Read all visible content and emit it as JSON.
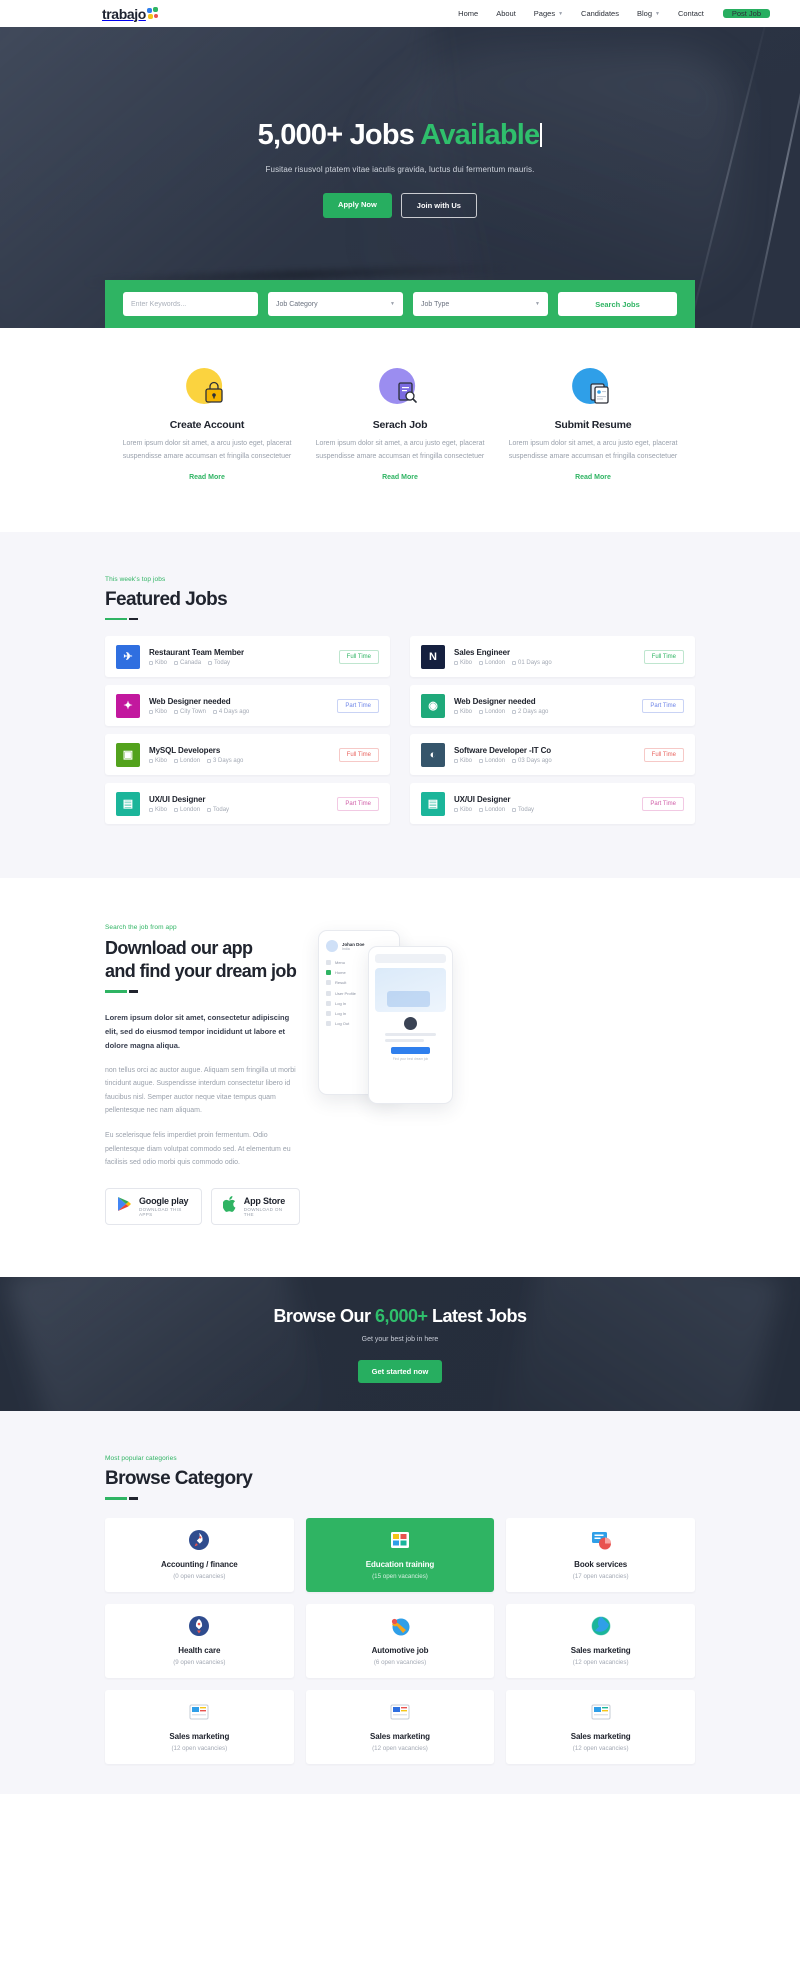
{
  "brand": {
    "name": "trabajo",
    "accent": "#2fb463"
  },
  "nav": {
    "items": [
      {
        "label": "Home",
        "caret": false
      },
      {
        "label": "About",
        "caret": false
      },
      {
        "label": "Pages",
        "caret": true
      },
      {
        "label": "Candidates",
        "caret": false
      },
      {
        "label": "Blog",
        "caret": true
      },
      {
        "label": "Contact",
        "caret": false
      }
    ],
    "cta": "Post Job"
  },
  "hero": {
    "title_plain": "5,000+ Jobs ",
    "title_accent": "Available",
    "subtitle": "Fusitae risusvol ptatem vitae iaculis gravida, luctus dui fermentum mauris.",
    "primary_button": "Apply Now",
    "secondary_button": "Join with Us"
  },
  "search": {
    "keyword_placeholder": "Enter Keywords...",
    "category_value": "Job Category",
    "type_value": "Job Type",
    "submit_label": "Search Jobs"
  },
  "features": [
    {
      "title": "Create Account",
      "text": "Lorem ipsum dolor sit amet, a arcu justo eget, placerat suspendisse amare accumsan et fringilla consectetuer",
      "link": "Read More",
      "icon": "lock-icon",
      "blob": "#fbd33f"
    },
    {
      "title": "Serach Job",
      "text": "Lorem ipsum dolor sit amet, a arcu justo eget, placerat suspendisse amare accumsan et fringilla consectetuer",
      "link": "Read More",
      "icon": "document-search-icon",
      "blob": "#9b8df0"
    },
    {
      "title": "Submit Resume",
      "text": "Lorem ipsum dolor sit amet, a arcu justo eget, placerat suspendisse amare accumsan et fringilla consectetuer",
      "link": "Read More",
      "icon": "resume-icon",
      "blob": "#2f9fe8"
    }
  ],
  "featured_jobs": {
    "eyebrow": "This week's top jobs",
    "title": "Featured Jobs",
    "items": [
      {
        "title": "Restaurant Team Member",
        "company": "Kibo",
        "location": "Canada",
        "posted": "Today",
        "tag": "Full Time",
        "tag_style": "tag-full",
        "logo_bg": "#2f6fe0",
        "logo_glyph": "✈"
      },
      {
        "title": "Sales Engineer",
        "company": "Kibo",
        "location": "London",
        "posted": "01 Days ago",
        "tag": "Full Time",
        "tag_style": "tag-full",
        "logo_bg": "#15203f",
        "logo_glyph": "N"
      },
      {
        "title": "Web Designer needed",
        "company": "Kibo",
        "location": "City Town",
        "posted": "4 Days ago",
        "tag": "Part Time",
        "tag_style": "tag-part",
        "logo_bg": "#c2189e",
        "logo_glyph": "✦"
      },
      {
        "title": "Web Designer needed",
        "company": "Kibo",
        "location": "London",
        "posted": "2 Days ago",
        "tag": "Part Time",
        "tag_style": "tag-part",
        "logo_bg": "#1fa97a",
        "logo_glyph": "◉"
      },
      {
        "title": "MySQL Developers",
        "company": "Kibo",
        "location": "London",
        "posted": "3 Days ago",
        "tag": "Full Time",
        "tag_style": "tag-full-r",
        "logo_bg": "#53a21d",
        "logo_glyph": "▣"
      },
      {
        "title": "Software Developer -IT Co",
        "company": "Kibo",
        "location": "London",
        "posted": "03 Days ago",
        "tag": "Full Time",
        "tag_style": "tag-full-r",
        "logo_bg": "#35556b",
        "logo_glyph": "◐"
      },
      {
        "title": "UX/UI Designer",
        "company": "Kibo",
        "location": "London",
        "posted": "Today",
        "tag": "Part Time",
        "tag_style": "tag-part-p",
        "logo_bg": "#1bb59a",
        "logo_glyph": "▤"
      },
      {
        "title": "UX/UI Designer",
        "company": "Kibo",
        "location": "London",
        "posted": "Today",
        "tag": "Part Time",
        "tag_style": "tag-part-p",
        "logo_bg": "#1bb59a",
        "logo_glyph": "▤"
      }
    ]
  },
  "app": {
    "eyebrow": "Search the job from app",
    "title_line1": "Download our app",
    "title_line2": "and find your dream job",
    "lead": "Lorem ipsum dolor sit amet, consectetur adipiscing elit, sed do eiusmod tempor incididunt ut labore et dolore magna aliqua.",
    "body1": "non tellus orci ac auctor augue. Aliquam sem fringilla ut morbi tincidunt augue. Suspendisse interdum consectetur libero id faucibus nisl. Semper auctor neque vitae tempus quam pellentesque nec nam aliquam.",
    "body2": "Eu scelerisque felis imperdiet proin fermentum. Odio pellentesque diam volutpat commodo sed. At elementum eu facilisis sed odio morbi quis commodo odio.",
    "store": [
      {
        "name": "Google play",
        "sub": "DOWNLOAD THIS APPS",
        "icon": "google-play-icon"
      },
      {
        "name": "App Store",
        "sub": "DOWNLOAD ON THE",
        "icon": "apple-icon"
      }
    ],
    "phone_mock": {
      "user_name": "Johan Doe",
      "user_role": "India",
      "menu_items": [
        "Menu",
        "Home",
        "Result",
        "User Profile",
        "Log In",
        "Log In",
        "Log Out"
      ],
      "card_button": "Sign In",
      "caption": "Find your best dream job"
    }
  },
  "cta": {
    "title_pre": "Browse Our ",
    "title_accent": "6,000+",
    "title_post": " Latest Jobs",
    "subtitle": "Get your best job in here",
    "button": "Get started now"
  },
  "categories": {
    "eyebrow": "Most popular categories",
    "title": "Browse Category",
    "items": [
      {
        "name": "Accounting / finance",
        "vacancies": "(0 open vacancies)",
        "active": false,
        "icon": "rocket-icon",
        "c1": "#2f6fe0",
        "c2": "#e8534f"
      },
      {
        "name": "Education training",
        "vacancies": "(15 open vacancies)",
        "active": true,
        "icon": "books-icon",
        "c1": "#f5c518",
        "c2": "#e8534f"
      },
      {
        "name": "Book services",
        "vacancies": "(17 open vacancies)",
        "active": false,
        "icon": "bookchart-icon",
        "c1": "#2f9fe8",
        "c2": "#e8534f"
      },
      {
        "name": "Health care",
        "vacancies": "(9 open vacancies)",
        "active": false,
        "icon": "rocket-icon",
        "c1": "#2f6fe0",
        "c2": "#e8534f"
      },
      {
        "name": "Automotive job",
        "vacancies": "(6 open vacancies)",
        "active": false,
        "icon": "tools-icon",
        "c1": "#f5a31a",
        "c2": "#e8534f"
      },
      {
        "name": "Sales marketing",
        "vacancies": "(12 open vacancies)",
        "active": false,
        "icon": "globe-icon",
        "c1": "#1bb59a",
        "c2": "#2f9fe8"
      },
      {
        "name": "Sales marketing",
        "vacancies": "(12 open vacancies)",
        "active": false,
        "icon": "news-icon",
        "c1": "#2f9fe8",
        "c2": "#f5c518"
      },
      {
        "name": "Sales marketing",
        "vacancies": "(12 open vacancies)",
        "active": false,
        "icon": "news-icon",
        "c1": "#2f6fe0",
        "c2": "#e8534f"
      },
      {
        "name": "Sales marketing",
        "vacancies": "(12 open vacancies)",
        "active": false,
        "icon": "news-icon",
        "c1": "#2f9fe8",
        "c2": "#1bb59a"
      }
    ]
  }
}
